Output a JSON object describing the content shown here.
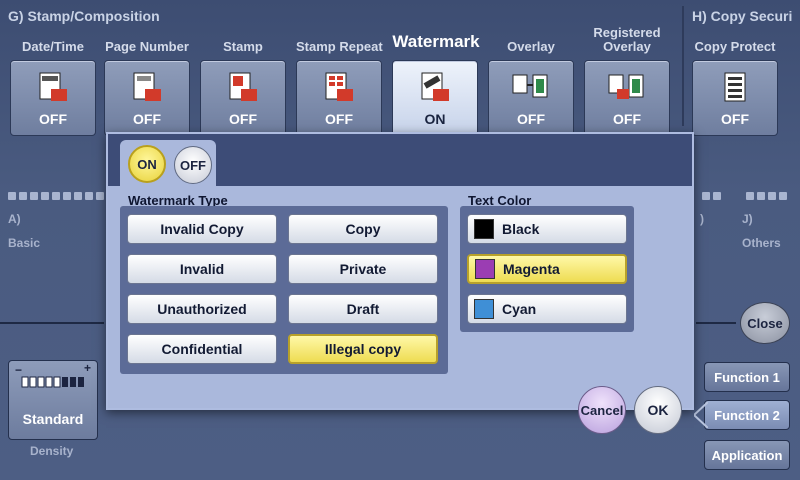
{
  "sections": {
    "stamp_composition": "G)  Stamp/Composition",
    "copy_security": "H)  Copy Securi"
  },
  "stamp_tabs": [
    {
      "label": "Date/Time",
      "state": "OFF",
      "icon": "date-time-icon"
    },
    {
      "label": "Page Number",
      "state": "OFF",
      "icon": "page-number-icon"
    },
    {
      "label": "Stamp",
      "state": "OFF",
      "icon": "stamp-icon"
    },
    {
      "label": "Stamp Repeat",
      "state": "OFF",
      "icon": "stamp-repeat-icon"
    },
    {
      "label": "Watermark",
      "state": "ON",
      "icon": "watermark-icon",
      "active": true
    },
    {
      "label": "Overlay",
      "state": "OFF",
      "icon": "overlay-icon"
    },
    {
      "label": "Registered",
      "label2": "Overlay",
      "state": "OFF",
      "icon": "registered-overlay-icon"
    },
    {
      "label": "Copy Protect",
      "state": "OFF",
      "icon": "copy-protect-icon"
    }
  ],
  "background": {
    "a_label": "A)",
    "a_sub": "Basic",
    "i_label": ")",
    "j_label": "J)",
    "j_sub": "Others",
    "density_value": "Standard",
    "density_label": "Density",
    "density_minus": "−",
    "density_plus": "+"
  },
  "right_panel": {
    "close": "Close",
    "function1": "Function 1",
    "function2": "Function 2",
    "application": "Application"
  },
  "dialog": {
    "on_label": "ON",
    "off_label": "OFF",
    "watermark_type_label": "Watermark Type",
    "watermark_types": [
      [
        "Invalid Copy",
        "Copy"
      ],
      [
        "Invalid",
        "Private"
      ],
      [
        "Unauthorized",
        "Draft"
      ],
      [
        "Confidential",
        "Illegal copy"
      ]
    ],
    "selected_type": "Illegal copy",
    "text_color_label": "Text Color",
    "text_colors": [
      {
        "label": "Black",
        "color": "#000000"
      },
      {
        "label": "Magenta",
        "color": "#9b3db3"
      },
      {
        "label": "Cyan",
        "color": "#3f8fd6"
      }
    ],
    "selected_color": "Magenta",
    "cancel": "Cancel",
    "ok": "OK"
  }
}
